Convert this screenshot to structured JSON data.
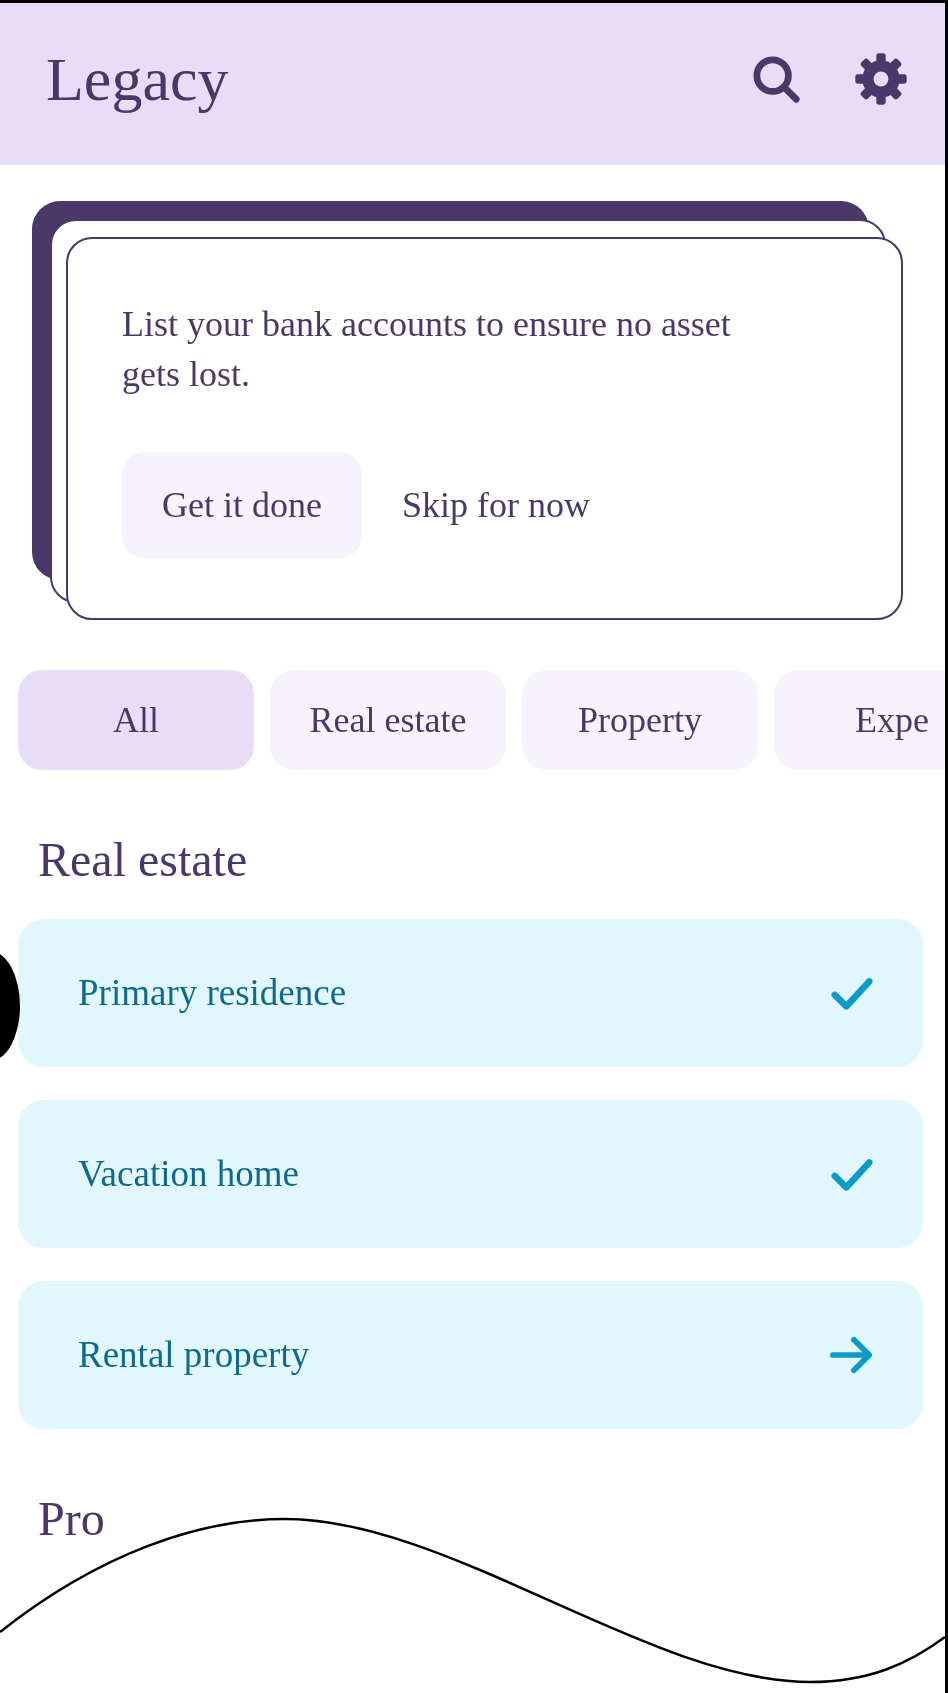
{
  "app_bar": {
    "title": "Legacy"
  },
  "prompt_card": {
    "message": "List your bank accounts to ensure no asset gets lost.",
    "primary_action": "Get it done",
    "secondary_action": "Skip for now"
  },
  "filters": [
    {
      "label": "All",
      "selected": true
    },
    {
      "label": "Real estate",
      "selected": false
    },
    {
      "label": "Property",
      "selected": false
    },
    {
      "label": "Expe",
      "selected": false
    }
  ],
  "sections": [
    {
      "title": "Real estate",
      "items": [
        {
          "label": "Primary residence",
          "kind": "done"
        },
        {
          "label": "Vacation home",
          "kind": "done"
        },
        {
          "label": "Rental property",
          "kind": "next"
        }
      ]
    },
    {
      "title": "Pro"
    }
  ]
}
